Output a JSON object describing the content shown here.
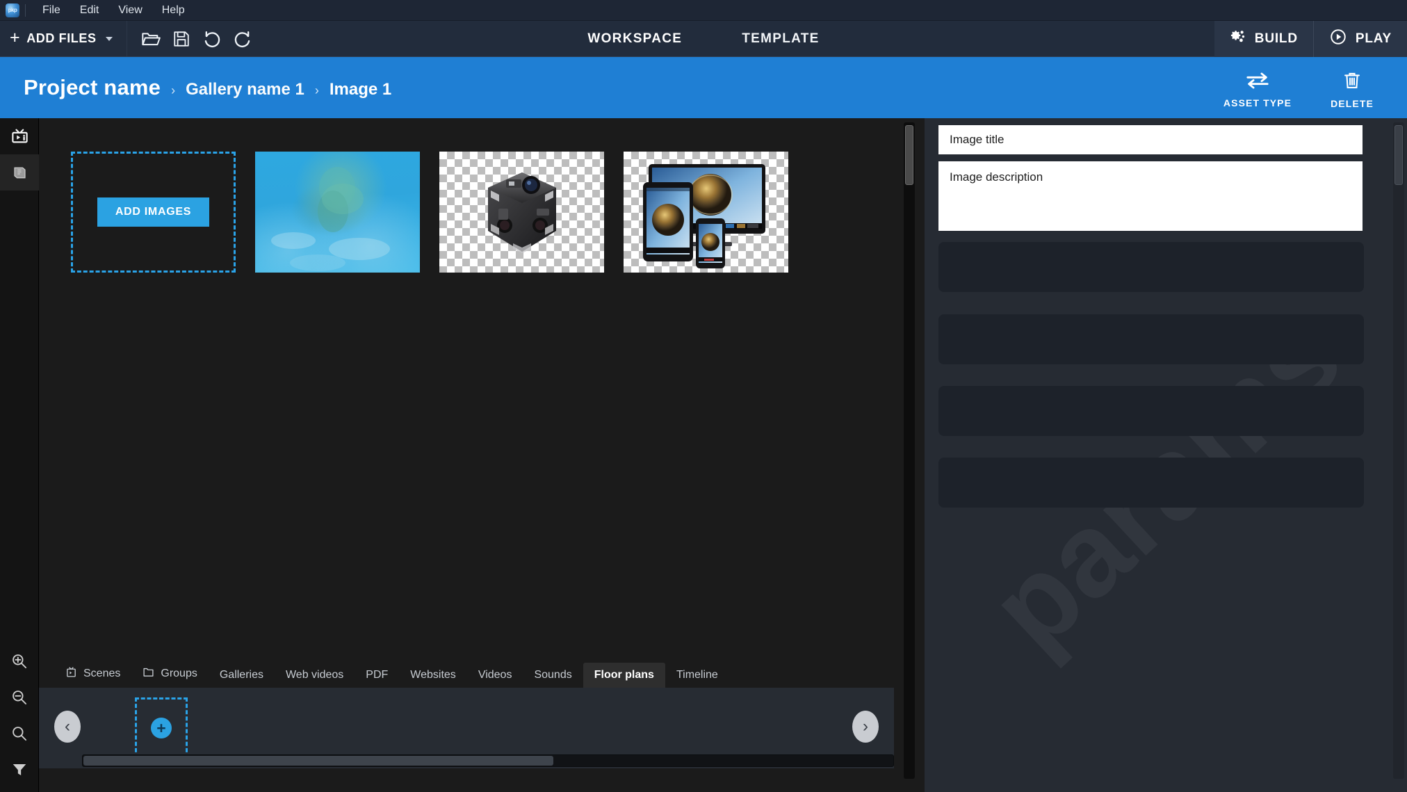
{
  "app": {
    "logo_label": "pkp",
    "accent_blue": "#1f7fd4",
    "bright_blue": "#2ba2e2",
    "toolbar_bg": "#222c3c",
    "menubar_bg": "#1e2635",
    "canvas_bg": "#1b1b1b",
    "panel_bg": "#262b33"
  },
  "menubar": {
    "items": [
      {
        "label": "File"
      },
      {
        "label": "Edit"
      },
      {
        "label": "View"
      },
      {
        "label": "Help"
      }
    ]
  },
  "toolbar": {
    "add_files_label": "ADD FILES",
    "add_files_plus": "+",
    "icons": [
      {
        "name": "open-folder-icon",
        "title": "Open"
      },
      {
        "name": "save-icon",
        "title": "Save"
      },
      {
        "name": "undo-icon",
        "title": "Undo"
      },
      {
        "name": "redo-icon",
        "title": "Redo"
      }
    ],
    "tabs": [
      {
        "label": "WORKSPACE",
        "active": true
      },
      {
        "label": "TEMPLATE",
        "active": false
      }
    ],
    "build_label": "BUILD",
    "play_label": "PLAY"
  },
  "breadcrumb": {
    "root": "Project name",
    "separator": "›",
    "level2": "Gallery name 1",
    "level3": "Image 1",
    "actions": [
      {
        "label": "ASSET TYPE",
        "icon": "swap-arrows-icon"
      },
      {
        "label": "DELETE",
        "icon": "trash-icon"
      }
    ]
  },
  "rail": {
    "top_items": [
      {
        "name": "media-tv-icon",
        "selected": false
      },
      {
        "name": "book-icon",
        "selected": true
      }
    ],
    "bottom_items": [
      {
        "name": "zoom-in-icon"
      },
      {
        "name": "zoom-out-icon"
      },
      {
        "name": "zoom-icon"
      },
      {
        "name": "filter-icon"
      }
    ]
  },
  "canvas": {
    "add_images_label": "ADD IMAGES",
    "thumbnails": [
      {
        "kind": "dropzone",
        "name": "add-images-dropzone"
      },
      {
        "kind": "photo",
        "name": "thumbnail-underwater",
        "alt": "Underwater blue scene"
      },
      {
        "kind": "photo-alpha",
        "name": "thumbnail-360-camera",
        "alt": "360 degree camera rig on transparency"
      },
      {
        "kind": "photo-alpha",
        "name": "thumbnail-devices",
        "alt": "Monitor tablet and phone showing 360 panorama"
      }
    ]
  },
  "bottom_tabs": {
    "items": [
      {
        "label": "Scenes",
        "icon": "scenes-icon",
        "active": false
      },
      {
        "label": "Groups",
        "icon": "groups-icon",
        "active": false
      },
      {
        "label": "Galleries",
        "icon": "",
        "active": false
      },
      {
        "label": "Web videos",
        "icon": "",
        "active": false
      },
      {
        "label": "PDF",
        "icon": "",
        "active": false
      },
      {
        "label": "Websites",
        "icon": "",
        "active": false
      },
      {
        "label": "Videos",
        "icon": "",
        "active": false
      },
      {
        "label": "Sounds",
        "icon": "",
        "active": false
      },
      {
        "label": "Floor plans",
        "icon": "",
        "active": true
      },
      {
        "label": "Timeline",
        "icon": "",
        "active": false
      }
    ],
    "prev_arrow": "‹",
    "next_arrow": "›",
    "add_slot_glyph": "+"
  },
  "panel": {
    "watermark": "params",
    "title_field": {
      "value": "Image title",
      "placeholder": "Image title"
    },
    "description_field": {
      "value": "Image description",
      "placeholder": "Image description"
    },
    "placeholder_rows": 4
  }
}
